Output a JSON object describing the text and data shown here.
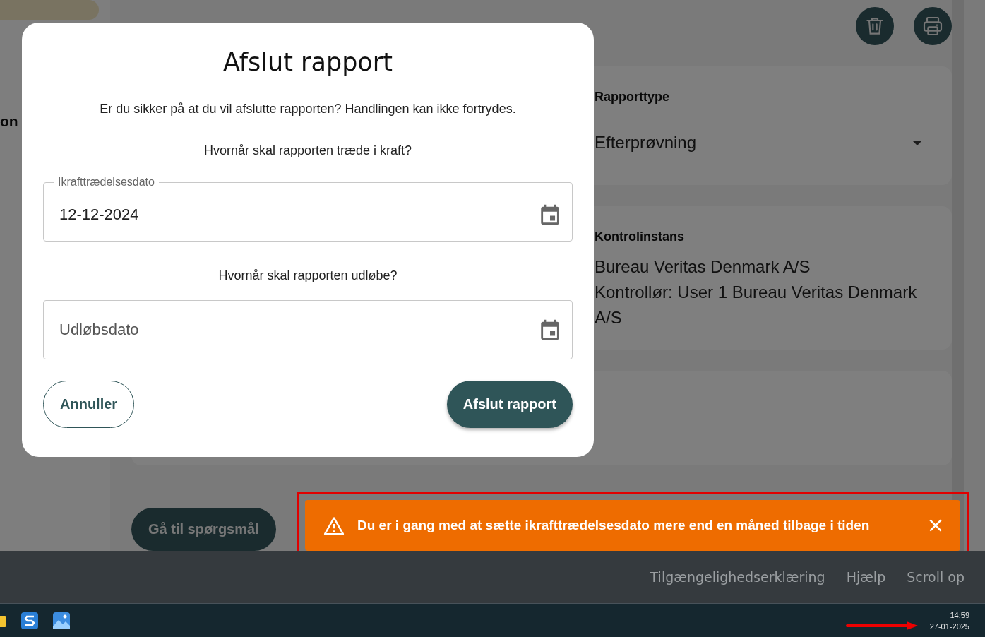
{
  "sidebar": {
    "items": [
      {
        "label": "on"
      }
    ]
  },
  "page": {
    "actions": [
      {
        "kind": "delete"
      },
      {
        "kind": "print"
      }
    ],
    "cards": [
      {
        "kind": "select",
        "label": "Rapporttype",
        "value": "Efterprøvning"
      },
      {
        "kind": "text",
        "label": "Kontrolinstans",
        "lines": [
          "Bureau Veritas Denmark A/S",
          "Kontrollør: User 1 Bureau Veritas Denmark A/S"
        ]
      },
      {
        "kind": "empty"
      }
    ],
    "next_button": "Gå til spørgsmål"
  },
  "dialog": {
    "title": "Afslut rapport",
    "message": "Er du sikker på at du vil afslutte rapporten? Handlingen kan ikke fortrydes.",
    "fields": [
      {
        "question": "Hvornår skal rapporten træde i kraft?",
        "label": "Ikrafttrædelsesdato",
        "value": "12-12-2024"
      },
      {
        "question": "Hvornår skal rapporten udløbe?",
        "placeholder": "Udløbsdato"
      }
    ],
    "buttons": [
      {
        "kind": "secondary",
        "label": "Annuller"
      },
      {
        "kind": "primary",
        "label": "Afslut rapport"
      }
    ]
  },
  "toast": {
    "kind": "warning",
    "message": "Du er i gang med at sætte ikrafttrædelsesdato mere end en måned tilbage i tiden"
  },
  "footer": {
    "links": [
      "Tilgængelighedserklæring",
      "Hjælp",
      "Scroll op"
    ]
  },
  "taskbar": {
    "time": "14:59",
    "date": "27-01-2025"
  }
}
